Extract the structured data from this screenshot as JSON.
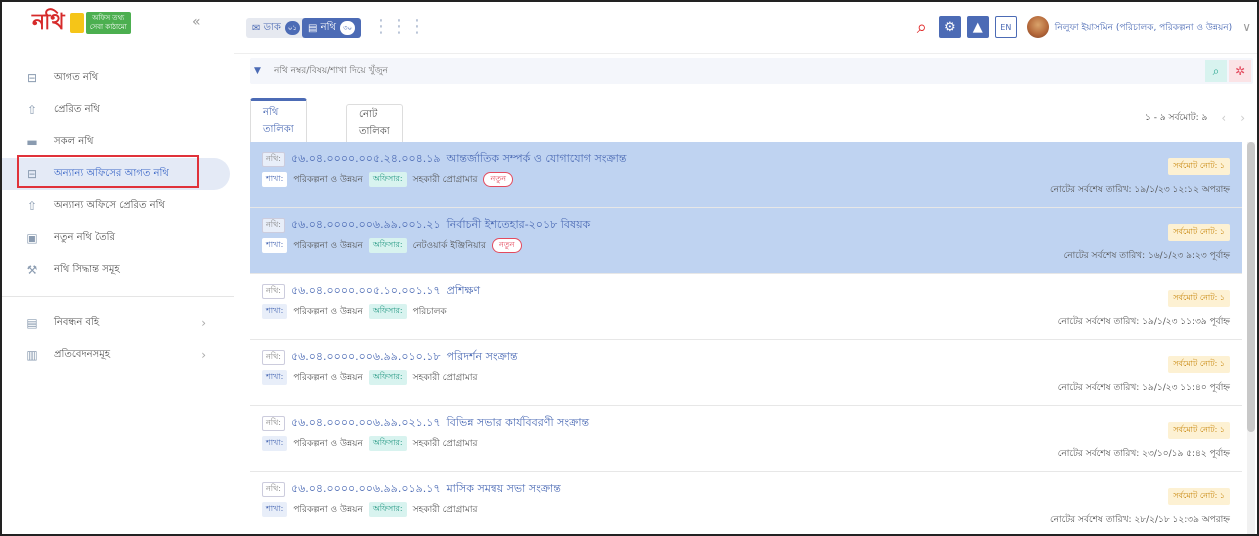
{
  "logo": {
    "word": "নথি",
    "tag_line1": "অফিস তথ্য",
    "tag_line2": "সেবা কাঠামো"
  },
  "sidebar": {
    "items": [
      {
        "label": "আগত নথি",
        "icon": "inbox-icon"
      },
      {
        "label": "প্রেরিত নথি",
        "icon": "upload-icon"
      },
      {
        "label": "সকল নথি",
        "icon": "folder-icon"
      },
      {
        "label": "অন্যান্য অফিসের আগত নথি",
        "icon": "inbox-icon"
      },
      {
        "label": "অন্যান্য অফিসে প্রেরিত নথি",
        "icon": "upload-icon"
      },
      {
        "label": "নতুন নথি তৈরি",
        "icon": "file-plus-icon"
      },
      {
        "label": "নথি সিদ্ধান্ত সমূহ",
        "icon": "gavel-icon"
      }
    ],
    "bottom_items": [
      {
        "label": "নিবন্ধন বহি",
        "icon": "book-icon"
      },
      {
        "label": "প্রতিবেদনসমূহ",
        "icon": "report-icon"
      }
    ]
  },
  "topbar": {
    "dak_label": "ডাক",
    "dak_count": "০১",
    "nothi_label": "নথি",
    "nothi_count": "৩০",
    "lang": "EN",
    "user": "নিলুফা ইয়াসমিন (পরিচালক, পরিকল্পনা ও উন্নয়ন)"
  },
  "search": {
    "placeholder": "নথি নম্বর/বিষয়/শাখা দিয়ে খুঁজুন"
  },
  "tabs": [
    {
      "label": "নথি তালিকা"
    },
    {
      "label": "নোট তালিকা"
    }
  ],
  "pager": {
    "text": "১ - ৯  সর্বমোট: ৯"
  },
  "labels": {
    "nothi": "নথি:",
    "shakha": "শাখা:",
    "officer": "অফিসার:",
    "new": "নতুন"
  },
  "rows": [
    {
      "number": "৫৬.০৪.০০০০.০০৫.২৪.০০৪.১৯",
      "subject": "আন্তর্জাতিক সম্পর্ক ও যোগাযোগ সংক্রান্ত",
      "branch": "পরিকল্পনা ও উন্নয়ন",
      "officer": "সহকারী প্রোগ্রামার",
      "is_new": true,
      "note_total": "সর্বমোট নোট: ১",
      "note_date": "নোটের সর্বশেষ তারিখ: ১৯/১/২৩ ১২:১২ অপরাহ্ন",
      "selected": true
    },
    {
      "number": "৫৬.০৪.০০০০.০০৬.৯৯.০০১.২১",
      "subject": "নির্বাচনী ইশতেহার-২০১৮ বিষয়ক",
      "branch": "পরিকল্পনা ও উন্নয়ন",
      "officer": "নেটওয়ার্ক ইঞ্জিনিয়ার",
      "is_new": true,
      "note_total": "সর্বমোট নোট: ১",
      "note_date": "নোটের সর্বশেষ তারিখ: ১৬/১/২৩ ৯:২৩ পূর্বাহ্ন",
      "selected": true
    },
    {
      "number": "৫৬.০৪.০০০০.০০৫.১০.০০১.১৭",
      "subject": "প্রশিক্ষণ",
      "branch": "পরিকল্পনা ও উন্নয়ন",
      "officer": "পরিচালক",
      "is_new": false,
      "note_total": "সর্বমোট নোট: ১",
      "note_date": "নোটের সর্বশেষ তারিখ: ১৯/১/২৩ ১১:৩৯ পূর্বাহ্ন",
      "selected": false
    },
    {
      "number": "৫৬.০৪.০০০০.০০৬.৯৯.০১০.১৮",
      "subject": "পরিদর্শন সংক্রান্ত",
      "branch": "পরিকল্পনা ও উন্নয়ন",
      "officer": "সহকারী প্রোগ্রামার",
      "is_new": false,
      "note_total": "সর্বমোট নোট: ১",
      "note_date": "নোটের সর্বশেষ তারিখ: ১৯/১/২৩ ১১:৪০ পূর্বাহ্ন",
      "selected": false
    },
    {
      "number": "৫৬.০৪.০০০০.০০৬.৯৯.০২১.১৭",
      "subject": "বিভিন্ন সভার কার্যবিবরণী সংক্রান্ত",
      "branch": "পরিকল্পনা ও উন্নয়ন",
      "officer": "সহকারী প্রোগ্রামার",
      "is_new": false,
      "note_total": "সর্বমোট নোট: ১",
      "note_date": "নোটের সর্বশেষ তারিখ: ২৩/১০/১৯ ৫:৪২ পূর্বাহ্ন",
      "selected": false
    },
    {
      "number": "৫৬.০৪.০০০০.০০৬.৯৯.০১৯.১৭",
      "subject": "মাসিক সমন্বয় সভা সংক্রান্ত",
      "branch": "পরিকল্পনা ও উন্নয়ন",
      "officer": "সহকারী প্রোগ্রামার",
      "is_new": false,
      "note_total": "সর্বমোট নোট: ১",
      "note_date": "নোটের সর্বশেষ তারিখ: ২৮/২/১৮ ১২:৩৯ অপরাহ্ন",
      "selected": false
    }
  ]
}
